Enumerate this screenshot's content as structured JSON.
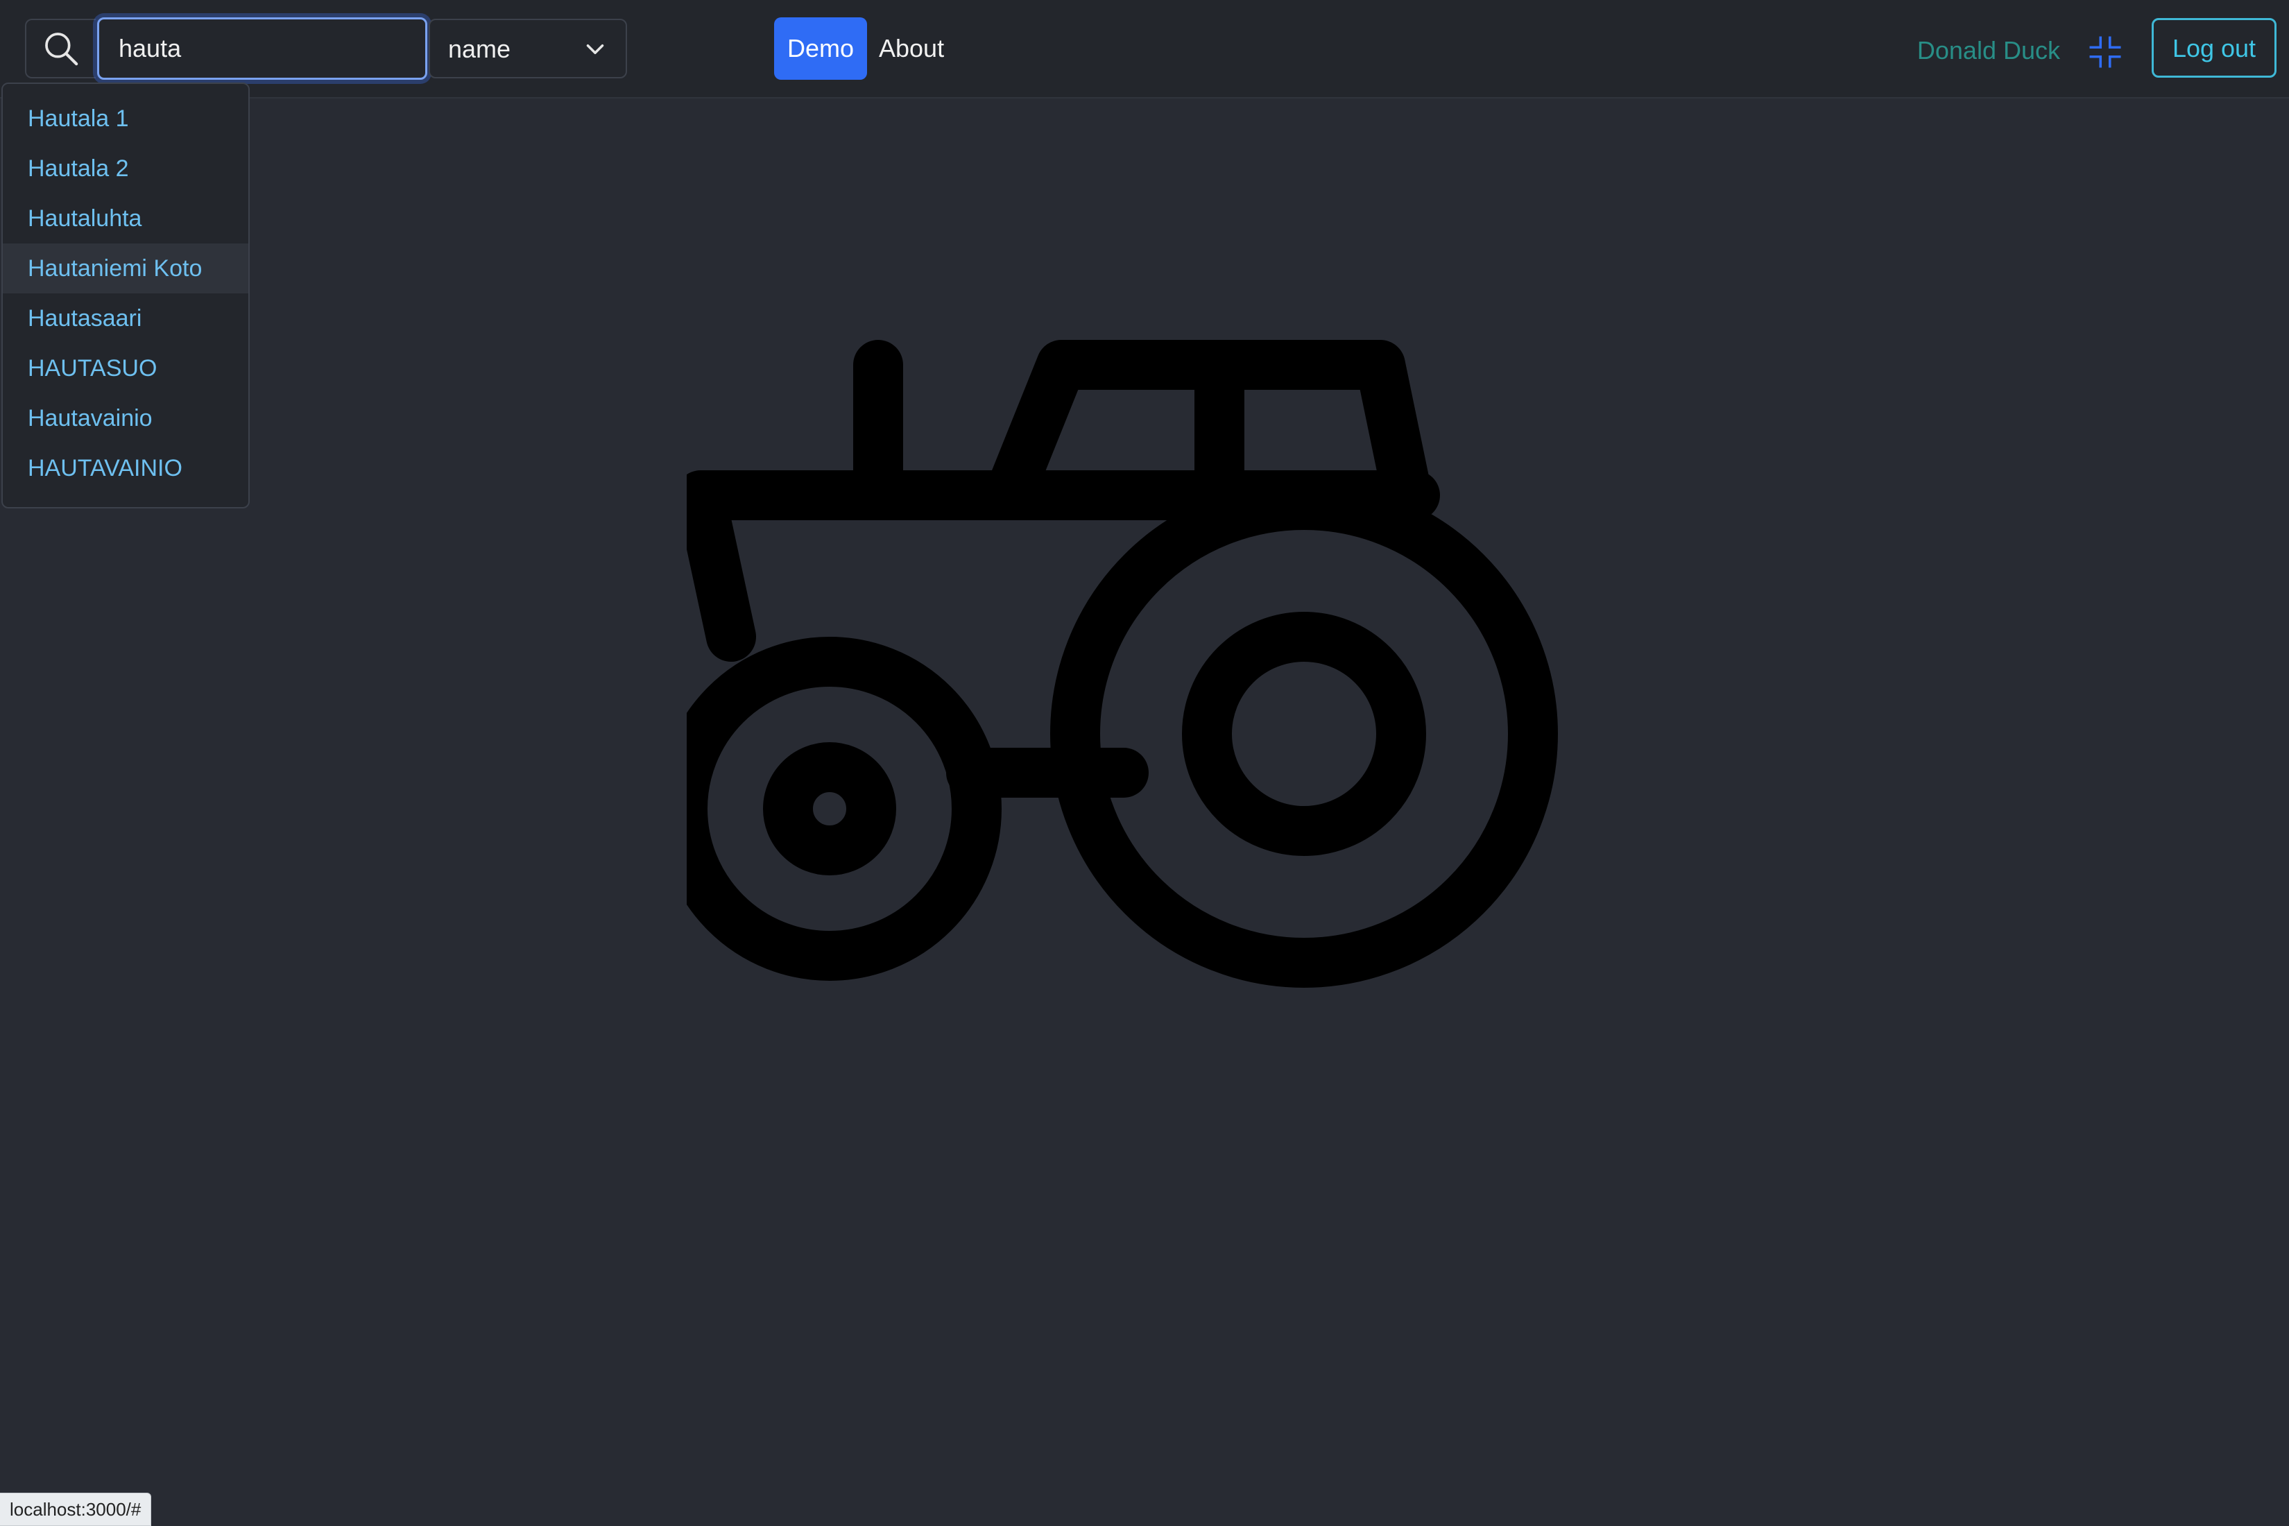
{
  "search": {
    "value": "hauta",
    "field_selected": "name"
  },
  "nav": {
    "demo_label": "Demo",
    "about_label": "About"
  },
  "user": {
    "name": "Donald Duck",
    "logout_label": "Log out"
  },
  "suggestions": [
    {
      "label": "Hautala 1"
    },
    {
      "label": "Hautala 2"
    },
    {
      "label": "Hautaluhta"
    },
    {
      "label": "Hautaniemi Koto",
      "highlighted": true
    },
    {
      "label": "Hautasaari"
    },
    {
      "label": "HAUTASUO"
    },
    {
      "label": "Hautavainio"
    },
    {
      "label": "HAUTAVAINIO"
    }
  ],
  "hero": {
    "icon": "tractor-icon"
  },
  "status_bar": {
    "url": "localhost:3000/#"
  },
  "colors": {
    "background": "#282b33",
    "navbar": "#23262c",
    "primary": "#2f6cf5",
    "link": "#6ec0f0",
    "user_name": "#2aa198",
    "outline_info": "#3fb8d6"
  }
}
